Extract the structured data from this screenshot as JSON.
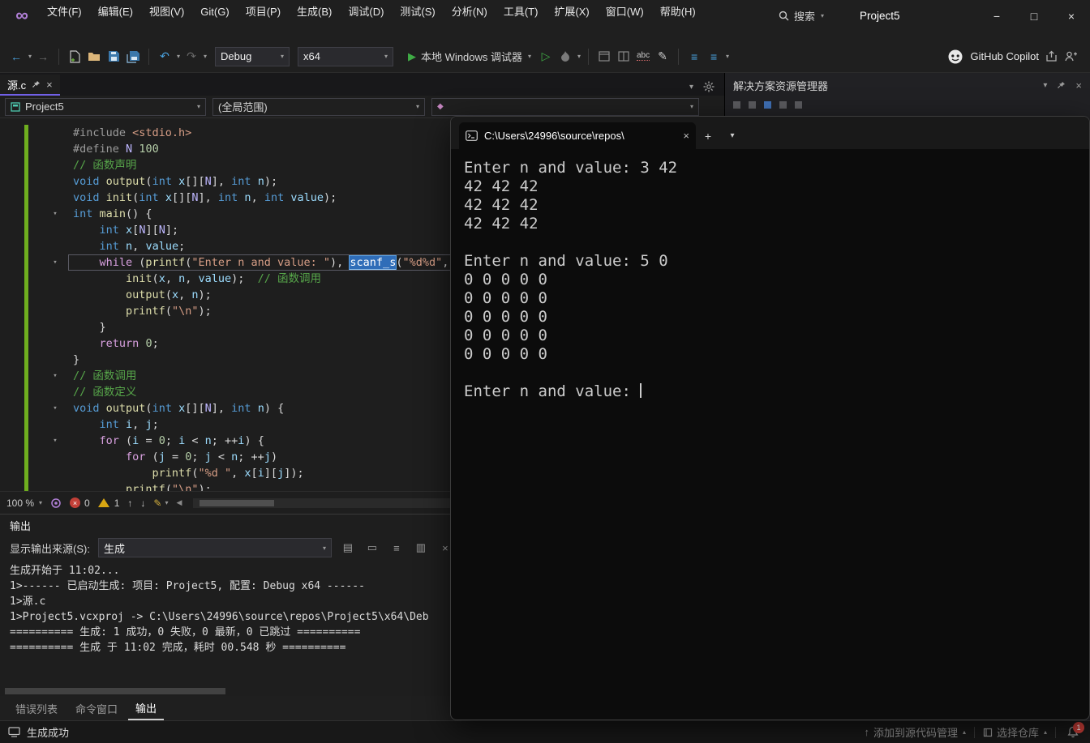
{
  "window": {
    "title": "Project5",
    "menus": [
      "文件(F)",
      "编辑(E)",
      "视图(V)",
      "Git(G)",
      "项目(P)",
      "生成(B)",
      "调试(D)",
      "测试(S)",
      "分析(N)",
      "工具(T)",
      "扩展(X)",
      "窗口(W)",
      "帮助(H)"
    ],
    "search_label": "搜索"
  },
  "icons": {
    "chevron_down": "▾",
    "minimize": "−",
    "maximize": "□",
    "close": "×",
    "back": "←",
    "forward": "→",
    "undo": "↶",
    "redo": "↷",
    "play": "▶",
    "play_outline": "▷",
    "arrow_up": "↑",
    "arrow_down": "↓",
    "scroll_left": "◀",
    "logo": "∞",
    "pencil": "✎",
    "list": "≡",
    "abc": "abc",
    "out_tool_1": "▤",
    "out_tool_2": "▭",
    "out_tool_3": "≡",
    "out_tool_4": "▥",
    "out_tool_5": "×"
  },
  "toolbar": {
    "config": "Debug",
    "platform": "x64",
    "run_label": "本地 Windows 调试器",
    "copilot_label": "GitHub Copilot"
  },
  "editor": {
    "tab_title": "源.c",
    "project_dropdown": "Project5",
    "scope_dropdown": "(全局范围)",
    "zoom": "100 %",
    "error_count": "0",
    "warning_count": "1",
    "code_lines": [
      {
        "t": [
          [
            "pp",
            "#include "
          ],
          [
            "str",
            "<stdio.h>"
          ]
        ]
      },
      {
        "t": [
          [
            "pp",
            "#define "
          ],
          [
            "mac",
            "N"
          ],
          [
            "pl",
            " "
          ],
          [
            "num",
            "100"
          ]
        ]
      },
      {
        "t": [
          [
            "com",
            "// 函数声明"
          ]
        ]
      },
      {
        "t": [
          [
            "kw",
            "void "
          ],
          [
            "fn",
            "output"
          ],
          [
            "pl",
            "("
          ],
          [
            "kw",
            "int"
          ],
          [
            "pl",
            " "
          ],
          [
            "var",
            "x"
          ],
          [
            "pl",
            "[]["
          ],
          [
            "mac",
            "N"
          ],
          [
            "pl",
            "], "
          ],
          [
            "kw",
            "int"
          ],
          [
            "pl",
            " "
          ],
          [
            "var",
            "n"
          ],
          [
            "pl",
            ");"
          ]
        ]
      },
      {
        "t": [
          [
            "kw",
            "void "
          ],
          [
            "fn",
            "init"
          ],
          [
            "pl",
            "("
          ],
          [
            "kw",
            "int"
          ],
          [
            "pl",
            " "
          ],
          [
            "var",
            "x"
          ],
          [
            "pl",
            "[]["
          ],
          [
            "mac",
            "N"
          ],
          [
            "pl",
            "], "
          ],
          [
            "kw",
            "int"
          ],
          [
            "pl",
            " "
          ],
          [
            "var",
            "n"
          ],
          [
            "pl",
            ", "
          ],
          [
            "kw",
            "int"
          ],
          [
            "pl",
            " "
          ],
          [
            "var",
            "value"
          ],
          [
            "pl",
            ");"
          ]
        ]
      },
      {
        "fold": true,
        "t": [
          [
            "kw",
            "int "
          ],
          [
            "fn",
            "main"
          ],
          [
            "pl",
            "() {"
          ]
        ]
      },
      {
        "t": [
          [
            "pl",
            "    "
          ],
          [
            "kw",
            "int "
          ],
          [
            "var",
            "x"
          ],
          [
            "pl",
            "["
          ],
          [
            "mac",
            "N"
          ],
          [
            "pl",
            "]["
          ],
          [
            "mac",
            "N"
          ],
          [
            "pl",
            "];"
          ]
        ]
      },
      {
        "t": [
          [
            "pl",
            "    "
          ],
          [
            "kw",
            "int "
          ],
          [
            "var",
            "n"
          ],
          [
            "pl",
            ", "
          ],
          [
            "var",
            "value"
          ],
          [
            "pl",
            ";"
          ]
        ]
      },
      {
        "fold": true,
        "cur": true,
        "t": [
          [
            "pl",
            "    "
          ],
          [
            "ctrl",
            "while"
          ],
          [
            "pl",
            " ("
          ],
          [
            "fn",
            "printf"
          ],
          [
            "pl",
            "("
          ],
          [
            "str",
            "\"Enter n and value: \""
          ],
          [
            "pl",
            "), "
          ],
          [
            "fnh",
            "scanf_s"
          ],
          [
            "pl",
            "("
          ],
          [
            "str",
            "\"%d%d\""
          ],
          [
            "pl",
            ", "
          ]
        ]
      },
      {
        "t": [
          [
            "pl",
            "        "
          ],
          [
            "fn",
            "init"
          ],
          [
            "pl",
            "("
          ],
          [
            "var",
            "x"
          ],
          [
            "pl",
            ", "
          ],
          [
            "var",
            "n"
          ],
          [
            "pl",
            ", "
          ],
          [
            "var",
            "value"
          ],
          [
            "pl",
            ");  "
          ],
          [
            "com",
            "// 函数调用"
          ]
        ]
      },
      {
        "t": [
          [
            "pl",
            "        "
          ],
          [
            "fn",
            "output"
          ],
          [
            "pl",
            "("
          ],
          [
            "var",
            "x"
          ],
          [
            "pl",
            ", "
          ],
          [
            "var",
            "n"
          ],
          [
            "pl",
            ");"
          ]
        ]
      },
      {
        "t": [
          [
            "pl",
            "        "
          ],
          [
            "fn",
            "printf"
          ],
          [
            "pl",
            "("
          ],
          [
            "str",
            "\"\\n\""
          ],
          [
            "pl",
            ");"
          ]
        ]
      },
      {
        "t": [
          [
            "pl",
            "    }"
          ]
        ]
      },
      {
        "t": [
          [
            "pl",
            "    "
          ],
          [
            "ctrl",
            "return"
          ],
          [
            "pl",
            " "
          ],
          [
            "num",
            "0"
          ],
          [
            "pl",
            ";"
          ]
        ]
      },
      {
        "t": [
          [
            "pl",
            "}"
          ]
        ]
      },
      {
        "fold": true,
        "t": [
          [
            "com",
            "// 函数调用"
          ]
        ]
      },
      {
        "t": [
          [
            "com",
            "// 函数定义"
          ]
        ]
      },
      {
        "fold": true,
        "t": [
          [
            "kw",
            "void "
          ],
          [
            "fn",
            "output"
          ],
          [
            "pl",
            "("
          ],
          [
            "kw",
            "int"
          ],
          [
            "pl",
            " "
          ],
          [
            "var",
            "x"
          ],
          [
            "pl",
            "[]["
          ],
          [
            "mac",
            "N"
          ],
          [
            "pl",
            "], "
          ],
          [
            "kw",
            "int"
          ],
          [
            "pl",
            " "
          ],
          [
            "var",
            "n"
          ],
          [
            "pl",
            ") {"
          ]
        ]
      },
      {
        "t": [
          [
            "pl",
            "    "
          ],
          [
            "kw",
            "int "
          ],
          [
            "var",
            "i"
          ],
          [
            "pl",
            ", "
          ],
          [
            "var",
            "j"
          ],
          [
            "pl",
            ";"
          ]
        ]
      },
      {
        "fold": true,
        "t": [
          [
            "pl",
            "    "
          ],
          [
            "ctrl",
            "for"
          ],
          [
            "pl",
            " ("
          ],
          [
            "var",
            "i"
          ],
          [
            "pl",
            " = "
          ],
          [
            "num",
            "0"
          ],
          [
            "pl",
            "; "
          ],
          [
            "var",
            "i"
          ],
          [
            "pl",
            " < "
          ],
          [
            "var",
            "n"
          ],
          [
            "pl",
            "; ++"
          ],
          [
            "var",
            "i"
          ],
          [
            "pl",
            ") {"
          ]
        ]
      },
      {
        "t": [
          [
            "pl",
            "        "
          ],
          [
            "ctrl",
            "for"
          ],
          [
            "pl",
            " ("
          ],
          [
            "var",
            "j"
          ],
          [
            "pl",
            " = "
          ],
          [
            "num",
            "0"
          ],
          [
            "pl",
            "; "
          ],
          [
            "var",
            "j"
          ],
          [
            "pl",
            " < "
          ],
          [
            "var",
            "n"
          ],
          [
            "pl",
            "; ++"
          ],
          [
            "var",
            "j"
          ],
          [
            "pl",
            ")"
          ]
        ]
      },
      {
        "t": [
          [
            "pl",
            "            "
          ],
          [
            "fn",
            "printf"
          ],
          [
            "pl",
            "("
          ],
          [
            "str",
            "\"%d \""
          ],
          [
            "pl",
            ", "
          ],
          [
            "var",
            "x"
          ],
          [
            "pl",
            "["
          ],
          [
            "var",
            "i"
          ],
          [
            "pl",
            "]["
          ],
          [
            "var",
            "j"
          ],
          [
            "pl",
            "]);"
          ]
        ]
      },
      {
        "t": [
          [
            "pl",
            "        "
          ],
          [
            "fn",
            "printf"
          ],
          [
            "pl",
            "("
          ],
          [
            "str",
            "\"\\n\""
          ],
          [
            "pl",
            ");"
          ]
        ]
      }
    ]
  },
  "output_panel": {
    "title": "输出",
    "source_label": "显示输出来源(S):",
    "source_value": "生成",
    "lines": [
      "生成开始于 11:02...",
      "1>------ 已启动生成: 项目: Project5, 配置: Debug x64 ------",
      "1>源.c",
      "1>Project5.vcxproj -> C:\\Users\\24996\\source\\repos\\Project5\\x64\\Deb",
      "========== 生成: 1 成功，0 失败，0 最新，0 已跳过 ==========",
      "========== 生成 于 11:02 完成，耗时 00.548 秒 =========="
    ],
    "tabs": [
      "错误列表",
      "命令窗口",
      "输出"
    ],
    "active_tab": "输出"
  },
  "solution_explorer": {
    "title": "解决方案资源管理器"
  },
  "status_bar": {
    "message": "生成成功",
    "add_source_control": "添加到源代码管理",
    "select_repo": "选择仓库",
    "notification_count": "1"
  },
  "console": {
    "tab_title": "C:\\Users\\24996\\source\\repos\\",
    "lines": [
      "Enter n and value: 3 42",
      "42 42 42",
      "42 42 42",
      "42 42 42",
      "",
      "Enter n and value: 5 0",
      "0 0 0 0 0",
      "0 0 0 0 0",
      "0 0 0 0 0",
      "0 0 0 0 0",
      "0 0 0 0 0",
      "",
      "Enter n and value: "
    ]
  },
  "colors": {
    "accent_purple": "#7160e8",
    "run_green": "#3fab45",
    "change_bar_green": "#6fae1f",
    "error_red": "#c24038",
    "warning_yellow": "#d9a712",
    "console_bg": "#0c0c0c",
    "editor_bg": "#1e1e1e"
  }
}
